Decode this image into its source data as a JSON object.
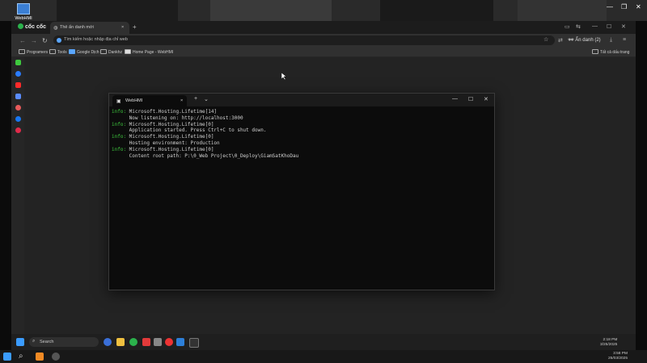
{
  "desktop": {
    "icon_label": "WebHMI"
  },
  "browser": {
    "logo": "cốc cốc",
    "tab_title": "Thẻ ẩn danh mới",
    "tab_close": "×",
    "new_tab": "+",
    "omnibox_placeholder": "Tìm kiếm hoặc nhập địa chỉ web",
    "incognito_label": "Ẩn danh (2)",
    "bookmarks": [
      "Programers",
      "Tools",
      "Google Dịch",
      "Dankhz",
      "Home Page - WebHMI"
    ],
    "all_bookmarks": "Tất cả dấu trang"
  },
  "terminal": {
    "tab_title": "WebHMI",
    "tab_close": "×",
    "new_tab": "+",
    "dropdown": "⌄",
    "min": "—",
    "max": "☐",
    "close": "✕",
    "lines": [
      {
        "level": "info:",
        "text": " Microsoft.Hosting.Lifetime[14]"
      },
      {
        "level": "",
        "text": "      Now listening on: http://localhost:3000"
      },
      {
        "level": "info:",
        "text": " Microsoft.Hosting.Lifetime[0]"
      },
      {
        "level": "",
        "text": "      Application started. Press Ctrl+C to shut down."
      },
      {
        "level": "info:",
        "text": " Microsoft.Hosting.Lifetime[0]"
      },
      {
        "level": "",
        "text": "      Hosting environment: Production"
      },
      {
        "level": "info:",
        "text": " Microsoft.Hosting.Lifetime[0]"
      },
      {
        "level": "",
        "text": "      Content root path: P:\\0_Web Project\\0_Deploy\\GiamSatKhoDau"
      }
    ]
  },
  "inner_taskbar": {
    "search_label": "Search",
    "time": "2:18 PM",
    "date": "3/25/2025"
  },
  "outer_taskbar": {
    "time": "3:58 PM",
    "date": "25/03/2025"
  },
  "colors": {
    "accent_green": "#3ec93e",
    "terminal_bg": "#0c0c0c"
  }
}
